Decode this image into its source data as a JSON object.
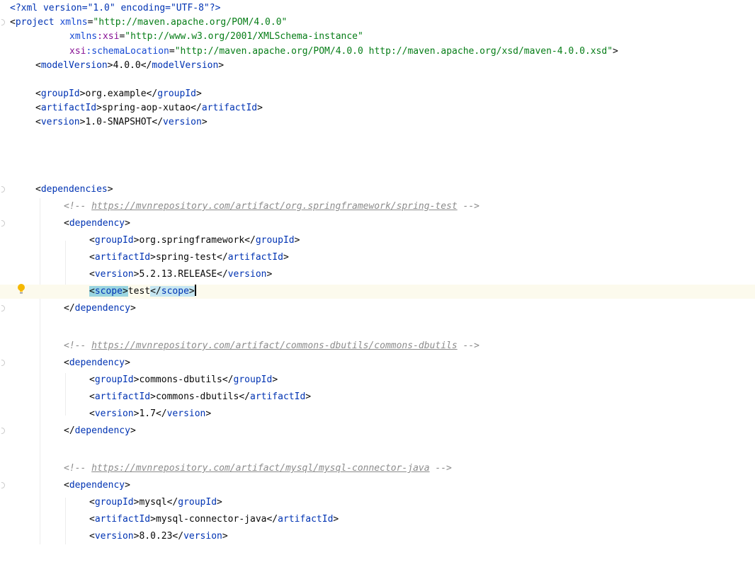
{
  "editor": {
    "file_type": "xml",
    "current_line": 20,
    "lines": {
      "l1": {
        "pi_open": "<?xml version=\"1.0\" encoding=\"UTF-8\"?>"
      },
      "l2": {
        "tag": "project",
        "attr_name": "xmlns",
        "attr_value": "\"http://maven.apache.org/POM/4.0.0\""
      },
      "l3": {
        "attr_ns": "xmlns",
        "attr_name": ":xsi",
        "attr_value": "\"http://www.w3.org/2001/XMLSchema-instance\""
      },
      "l4": {
        "attr_ns": "xsi",
        "attr_name": ":schemaLocation",
        "attr_value": "\"http://maven.apache.org/POM/4.0.0 http://maven.apache.org/xsd/maven-4.0.0.xsd\""
      },
      "l5": {
        "tag": "modelVersion",
        "value": "4.0.0"
      },
      "l7": {
        "tag": "groupId",
        "value": "org.example"
      },
      "l8": {
        "tag": "artifactId",
        "value": "spring-aop-xutao"
      },
      "l9": {
        "tag": "version",
        "value": "1.0-SNAPSHOT"
      },
      "l11": {
        "tag": "dependencies"
      },
      "l12": {
        "comment_open": "<!-- ",
        "link": "https://mvnrepository.com/artifact/org.springframework/spring-test",
        "comment_close": " -->"
      },
      "l13": {
        "tag": "dependency"
      },
      "l14": {
        "tag": "groupId",
        "value": "org.springframework"
      },
      "l15": {
        "tag": "artifactId",
        "value": "spring-test"
      },
      "l16": {
        "tag": "version",
        "value": "5.2.13.RELEASE"
      },
      "l17": {
        "tag": "scope",
        "value": "test"
      },
      "l18": {
        "tag": "dependency"
      },
      "l20": {
        "comment_open": "<!-- ",
        "link": "https://mvnrepository.com/artifact/commons-dbutils/commons-dbutils",
        "comment_close": " -->"
      },
      "l21": {
        "tag": "dependency"
      },
      "l22": {
        "tag": "groupId",
        "value": "commons-dbutils"
      },
      "l23": {
        "tag": "artifactId",
        "value": "commons-dbutils"
      },
      "l24": {
        "tag": "version",
        "value": "1.7"
      },
      "l25": {
        "tag": "dependency"
      },
      "l27": {
        "comment_open": "<!-- ",
        "link": "https://mvnrepository.com/artifact/mysql/mysql-connector-java",
        "comment_close": " -->"
      },
      "l28": {
        "tag": "dependency"
      },
      "l29": {
        "tag": "groupId",
        "value": "mysql"
      },
      "l30": {
        "tag": "artifactId",
        "value": "mysql-connector-java"
      },
      "l31": {
        "tag": "version",
        "value": "8.0.23"
      }
    },
    "gutter": {
      "intention_icon": "lightbulb-icon",
      "fold_icon": "fold-marker-icon"
    },
    "colors": {
      "tag": "#0033b3",
      "attribute": "#174ad4",
      "attribute_namespace": "#871094",
      "string": "#067d17",
      "comment": "#8c8c8c",
      "current_line": "#fcfaed",
      "matched_tag": "#c6e6f1",
      "bulb": "#f5b800"
    }
  }
}
